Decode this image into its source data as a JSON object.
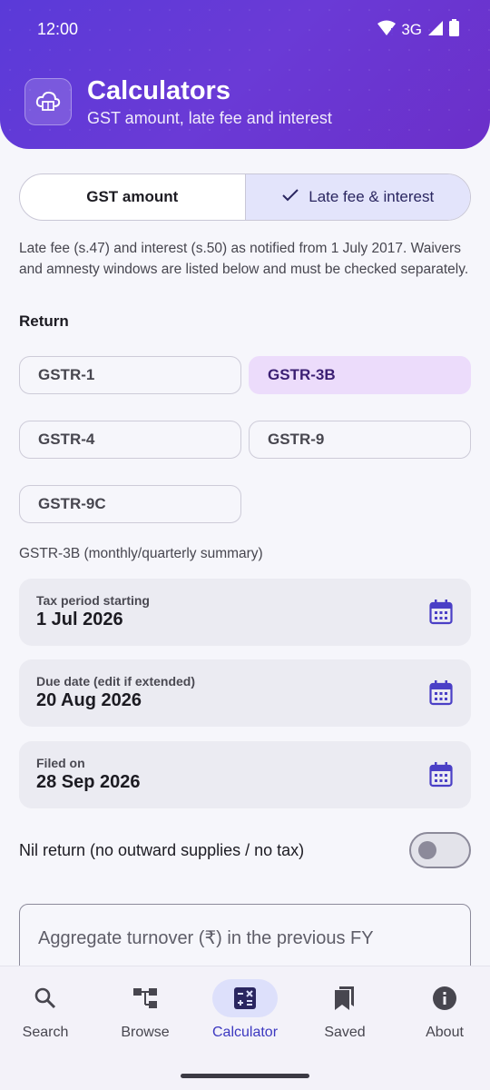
{
  "status_bar": {
    "time": "12:00",
    "network": "3G"
  },
  "header": {
    "title": "Calculators",
    "subtitle": "GST amount, late fee and interest"
  },
  "tabs": {
    "gst_amount": "GST amount",
    "late_fee": "Late fee & interest"
  },
  "description": "Late fee (s.47) and interest (s.50) as notified from 1 July 2017. Waivers and amnesty windows are listed below and must be checked separately.",
  "return_section": {
    "label": "Return",
    "options": [
      "GSTR-1",
      "GSTR-3B",
      "GSTR-4",
      "GSTR-9",
      "GSTR-9C"
    ],
    "selected": "GSTR-3B"
  },
  "return_caption": "GSTR-3B (monthly/quarterly summary)",
  "fields": {
    "tax_period": {
      "label": "Tax period starting",
      "value": "1 Jul 2026"
    },
    "due_date": {
      "label": "Due date (edit if extended)",
      "value": "20 Aug 2026"
    },
    "filed_on": {
      "label": "Filed on",
      "value": "28 Sep 2026"
    }
  },
  "nil_return": {
    "label": "Nil return (no outward supplies / no tax)",
    "on": false
  },
  "turnover_input": {
    "placeholder": "Aggregate turnover (₹) in the previous FY"
  },
  "bottom_nav": {
    "search": "Search",
    "browse": "Browse",
    "calculator": "Calculator",
    "saved": "Saved",
    "about": "About",
    "active": "Calculator"
  },
  "colors": {
    "primary": "#5b3ad8",
    "accent": "#3c38c0",
    "chip_selected": "#ecdcfb"
  }
}
